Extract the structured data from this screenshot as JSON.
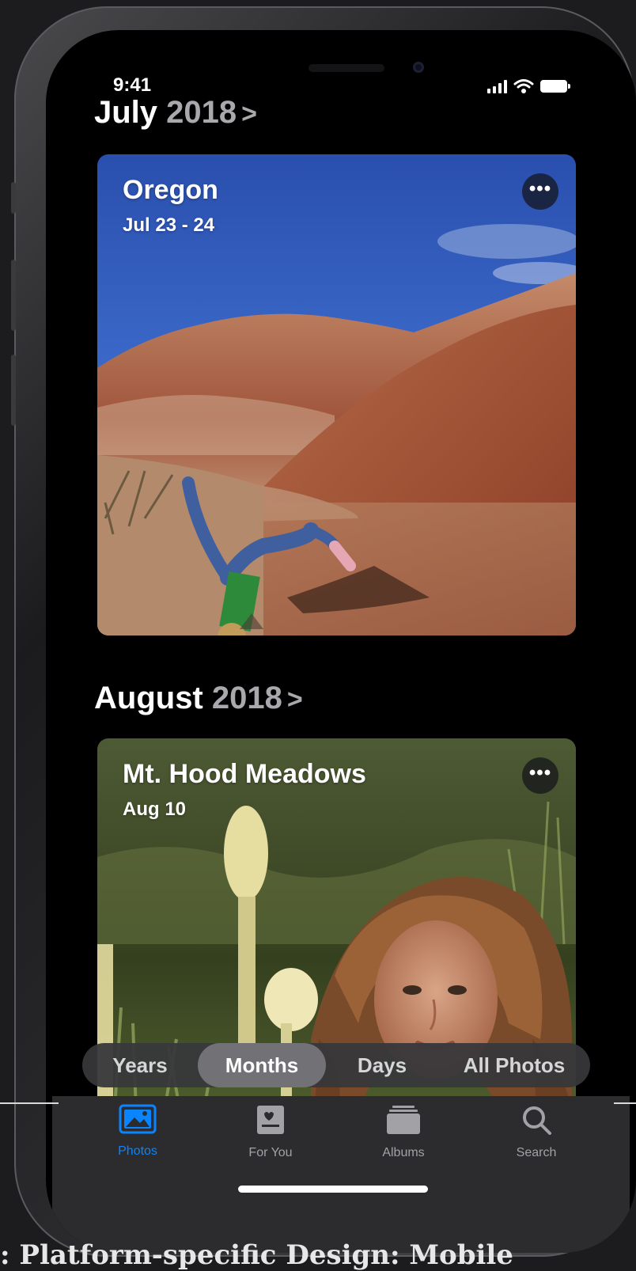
{
  "status_bar": {
    "time": "9:41"
  },
  "sections": [
    {
      "month": "July",
      "year": "2018",
      "chevron": ">",
      "card": {
        "title": "Oregon",
        "date": "Jul 23 - 24",
        "more": "•••"
      }
    },
    {
      "month": "August",
      "year": "2018",
      "chevron": ">",
      "card": {
        "title": "Mt. Hood Meadows",
        "date": "Aug 10",
        "more": "•••"
      }
    }
  ],
  "view_selector": {
    "options": [
      "Years",
      "Months",
      "Days",
      "All Photos"
    ],
    "selected": "Months"
  },
  "tab_bar": {
    "items": [
      {
        "label": "Photos",
        "icon": "photos-icon",
        "active": true
      },
      {
        "label": "For You",
        "icon": "for-you-icon",
        "active": false
      },
      {
        "label": "Albums",
        "icon": "albums-icon",
        "active": false
      },
      {
        "label": "Search",
        "icon": "search-icon",
        "active": false
      }
    ],
    "active_color": "#0a84ff"
  },
  "caption": ": Platform-specific Design: Mobile"
}
